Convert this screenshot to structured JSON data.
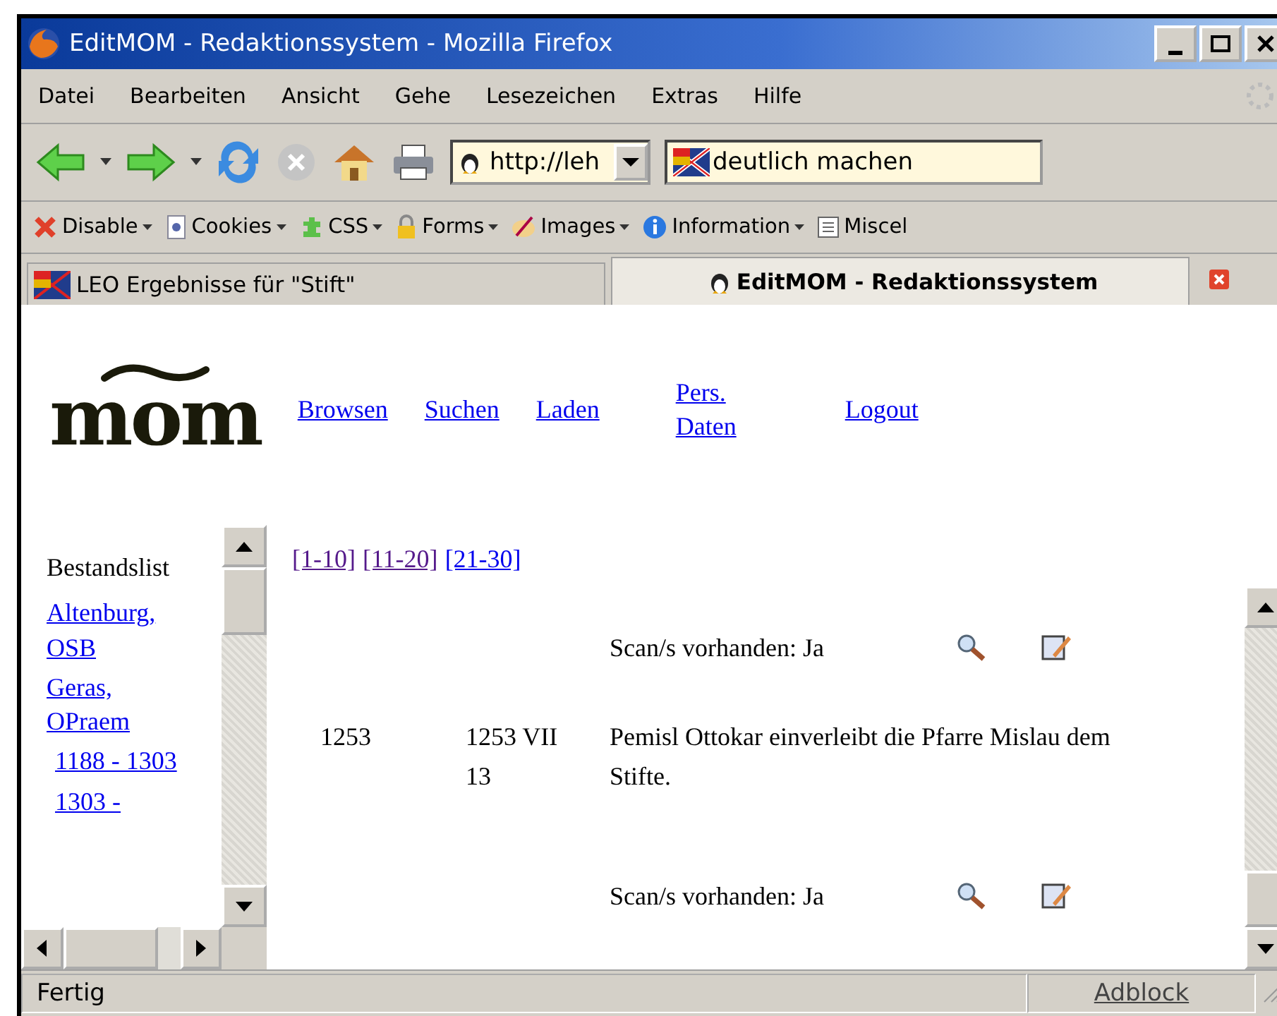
{
  "window": {
    "title": "EditMOM - Redaktionssystem - Mozilla Firefox"
  },
  "menu": [
    "Datei",
    "Bearbeiten",
    "Ansicht",
    "Gehe",
    "Lesezeichen",
    "Extras",
    "Hilfe"
  ],
  "toolbar": {
    "address": "http://leh",
    "search": "deutlich machen"
  },
  "extensions": [
    "Disable",
    "Cookies",
    "CSS",
    "Forms",
    "Images",
    "Information",
    "Miscel"
  ],
  "tabs": [
    {
      "label": "LEO Ergebnisse für \"Stift\"",
      "selected": false
    },
    {
      "label": "EditMOM - Redaktionssystem",
      "selected": true
    }
  ],
  "logo": "mom",
  "site_nav": [
    "Browsen",
    "Suchen",
    "Laden",
    "Pers. Daten",
    "Logout"
  ],
  "sidebar": {
    "heading": "Bestandslist",
    "items": [
      {
        "label": "Altenburg, OSB"
      },
      {
        "label": "Geras, OPraem",
        "children": [
          {
            "label": "1188 - 1303"
          },
          {
            "label": "1303 -"
          }
        ]
      }
    ]
  },
  "pager": [
    {
      "label": "[1-10]",
      "visited": true
    },
    {
      "label": "[11-20]",
      "visited": true
    },
    {
      "label": "[21-30]",
      "visited": false
    }
  ],
  "records": [
    {
      "kind": "scan",
      "text": "Scan/s vorhanden: Ja"
    },
    {
      "kind": "entry",
      "column_1": "1253",
      "column_2": "1253 VII 13",
      "column_3": "Pemisl Ottokar einverleibt die Pfarre Mislau dem Stifte."
    },
    {
      "kind": "scan",
      "text": "Scan/s vorhanden: Ja"
    }
  ],
  "status_bar": {
    "text": "Fertig",
    "panel": "Adblock"
  }
}
